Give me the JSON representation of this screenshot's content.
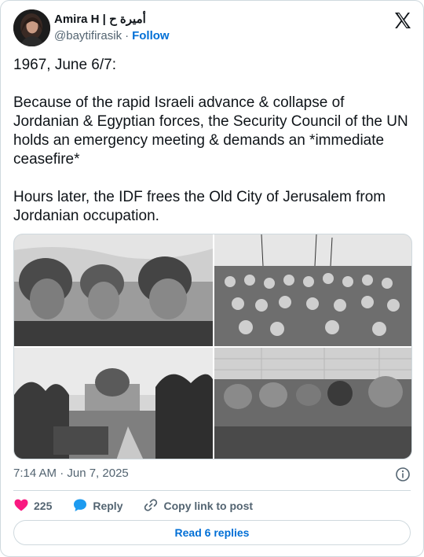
{
  "author": {
    "display_name": "Amira H | أميرة ح",
    "handle": "@baytifirasik",
    "separator": "·",
    "follow_label": "Follow"
  },
  "tweet": {
    "text": "1967, June 6/7:\n\nBecause of the rapid Israeli advance & collapse of Jordanian & Egyptian forces, the Security Council of the UN holds an emergency meeting & demands an *immediate ceasefire*\n\nHours later, the IDF frees the Old City of Jerusalem from Jordanian occupation.",
    "timestamp": "7:14 AM · Jun 7, 2025"
  },
  "actions": {
    "like_count": "225",
    "reply_label": "Reply",
    "copy_label": "Copy link to post"
  },
  "footer": {
    "read_replies_label": "Read 6 replies"
  },
  "colors": {
    "accent": "#006fd6",
    "like": "#f91880",
    "reply": "#1d9bf0",
    "secondary_text": "#536471",
    "border": "#cfd9de"
  },
  "icons": [
    "x-logo-icon",
    "info-icon",
    "heart-icon",
    "reply-bubble-icon",
    "link-icon"
  ]
}
